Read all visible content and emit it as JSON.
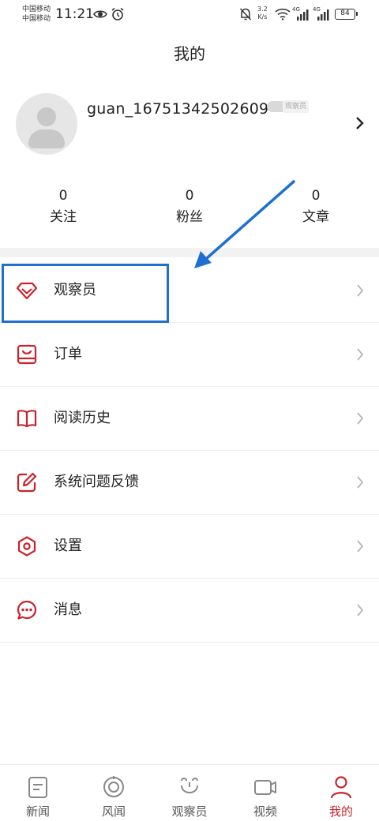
{
  "status_bar": {
    "carrier_1": "中国移动",
    "carrier_2": "中国移动",
    "time": "11:21",
    "speed_value": "3.2",
    "speed_unit": "K/s",
    "signal_1_type": "4G",
    "signal_2_type": "4G",
    "battery": "84",
    "icons": [
      "eye-icon",
      "alarm-icon",
      "bell-off-icon",
      "wifi-icon",
      "signal-icon",
      "signal-icon",
      "battery-icon"
    ]
  },
  "header": {
    "title": "我的"
  },
  "profile": {
    "username": "guan_16751342502609",
    "badge": "观察员",
    "icons": [
      "avatar-placeholder-icon",
      "chevron-right-icon"
    ]
  },
  "stats": [
    {
      "value": "0",
      "label": "关注"
    },
    {
      "value": "0",
      "label": "粉丝"
    },
    {
      "value": "0",
      "label": "文章"
    }
  ],
  "menu": [
    {
      "label": "观察员",
      "icon": "diamond-icon"
    },
    {
      "label": "订单",
      "icon": "order-bag-icon"
    },
    {
      "label": "阅读历史",
      "icon": "book-icon"
    },
    {
      "label": "系统问题反馈",
      "icon": "edit-icon"
    },
    {
      "label": "设置",
      "icon": "settings-hexagon-icon"
    },
    {
      "label": "消息",
      "icon": "message-bubble-icon"
    }
  ],
  "bottom_nav": [
    {
      "label": "新闻",
      "icon": "news-icon"
    },
    {
      "label": "风闻",
      "icon": "target-icon"
    },
    {
      "label": "观察员",
      "icon": "observer-face-icon"
    },
    {
      "label": "视频",
      "icon": "video-camera-icon"
    },
    {
      "label": "我的",
      "icon": "person-icon",
      "active": true
    }
  ],
  "colors": {
    "accent": "#c8232c",
    "annotation": "#1f6fd0",
    "divider": "#efefef",
    "section_gap": "#f2f2f2",
    "nav_inactive": "#888888"
  }
}
